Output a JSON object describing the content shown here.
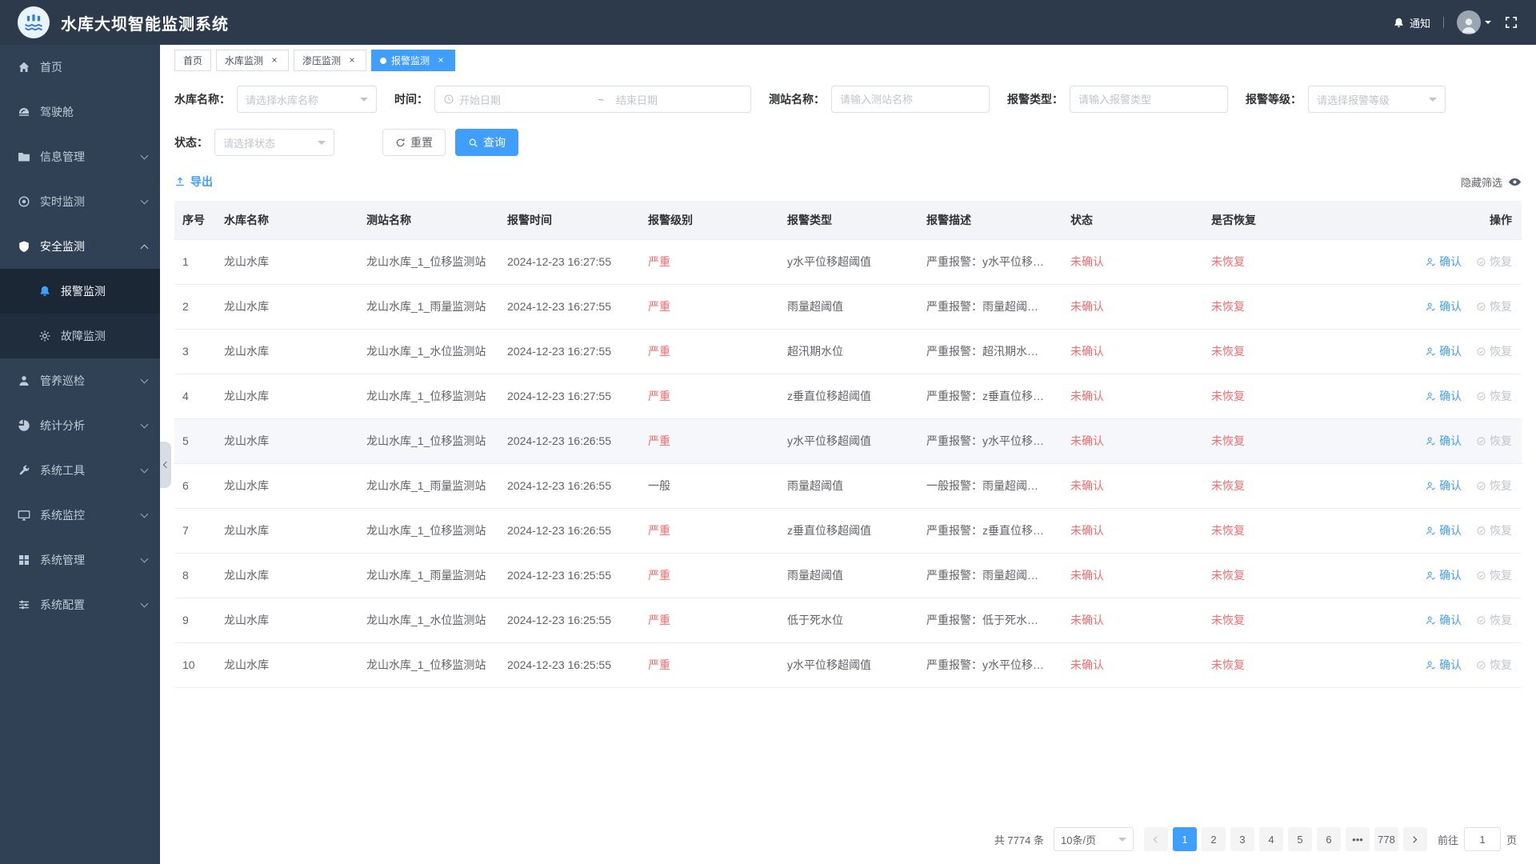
{
  "colors": {
    "primary": "#409eff",
    "danger": "#f56c6c",
    "header_bg": "#2d3a4b",
    "sidebar_bg": "#304156",
    "submenu_bg": "#1f2d3d"
  },
  "icons": {
    "app_logo": "dam-waves",
    "notification": "bell",
    "avatar": "user-photo",
    "fullscreen": "expand-corners",
    "export": "upload-arrow",
    "hide_filter": "eye",
    "query": "magnifier",
    "reset": "refresh-arrow",
    "date": "clock",
    "confirm_op": "user-check",
    "recover_op": "circle-check"
  },
  "header": {
    "title": "水库大坝智能监测系统",
    "notification_label": "通知"
  },
  "sidebar": {
    "items": [
      {
        "label": "首页"
      },
      {
        "label": "驾驶舱"
      },
      {
        "label": "信息管理"
      },
      {
        "label": "实时监测"
      },
      {
        "label": "安全监测",
        "children": [
          {
            "label": "报警监测"
          },
          {
            "label": "故障监测"
          }
        ]
      },
      {
        "label": "管养巡检"
      },
      {
        "label": "统计分析"
      },
      {
        "label": "系统工具"
      },
      {
        "label": "系统监控"
      },
      {
        "label": "系统管理"
      },
      {
        "label": "系统配置"
      }
    ]
  },
  "tabs": [
    {
      "label": "首页"
    },
    {
      "label": "水库监测"
    },
    {
      "label": "渗压监测"
    },
    {
      "label": "报警监测"
    }
  ],
  "filters": {
    "reservoir_label": "水库名称：",
    "reservoir_placeholder": "请选择水库名称",
    "time_label": "时间：",
    "start_placeholder": "开始日期",
    "separator": "~",
    "end_placeholder": "结束日期",
    "station_label": "测站名称：",
    "station_placeholder": "请输入测站名称",
    "type_label": "报警类型：",
    "type_placeholder": "请输入报警类型",
    "level_label": "报警等级：",
    "level_placeholder": "请选择报警等级",
    "status_label": "状态：",
    "status_placeholder": "请选择状态",
    "reset_label": "重置",
    "query_label": "查询"
  },
  "toolbar": {
    "export_label": "导出",
    "hide_filter_label": "隐藏筛选"
  },
  "table": {
    "columns": [
      "序号",
      "水库名称",
      "测站名称",
      "报警时间",
      "报警级别",
      "报警类型",
      "报警描述",
      "状态",
      "是否恢复",
      "操作"
    ],
    "confirm_label": "确认",
    "recover_label": "恢复",
    "rows": [
      {
        "no": "1",
        "reservoir": "龙山水库",
        "station": "龙山水库_1_位移监测站",
        "time": "2024-12-23 16:27:55",
        "level": "严重",
        "level_class": "red",
        "type": "y水平位移超阈值",
        "desc": "严重报警：y水平位移…",
        "status": "未确认",
        "recovered": "未恢复",
        "row_class": ""
      },
      {
        "no": "2",
        "reservoir": "龙山水库",
        "station": "龙山水库_1_雨量监测站",
        "time": "2024-12-23 16:27:55",
        "level": "严重",
        "level_class": "red",
        "type": "雨量超阈值",
        "desc": "严重报警：雨量超阈…",
        "status": "未确认",
        "recovered": "未恢复",
        "row_class": ""
      },
      {
        "no": "3",
        "reservoir": "龙山水库",
        "station": "龙山水库_1_水位监测站",
        "time": "2024-12-23 16:27:55",
        "level": "严重",
        "level_class": "red",
        "type": "超汛期水位",
        "desc": "严重报警：超汛期水…",
        "status": "未确认",
        "recovered": "未恢复",
        "row_class": ""
      },
      {
        "no": "4",
        "reservoir": "龙山水库",
        "station": "龙山水库_1_位移监测站",
        "time": "2024-12-23 16:27:55",
        "level": "严重",
        "level_class": "red",
        "type": "z垂直位移超阈值",
        "desc": "严重报警：z垂直位移…",
        "status": "未确认",
        "recovered": "未恢复",
        "row_class": ""
      },
      {
        "no": "5",
        "reservoir": "龙山水库",
        "station": "龙山水库_1_位移监测站",
        "time": "2024-12-23 16:26:55",
        "level": "严重",
        "level_class": "red",
        "type": "y水平位移超阈值",
        "desc": "严重报警：y水平位移…",
        "status": "未确认",
        "recovered": "未恢复",
        "row_class": "hl"
      },
      {
        "no": "6",
        "reservoir": "龙山水库",
        "station": "龙山水库_1_雨量监测站",
        "time": "2024-12-23 16:26:55",
        "level": "一般",
        "level_class": "plain",
        "type": "雨量超阈值",
        "desc": "一般报警：雨量超阈…",
        "status": "未确认",
        "recovered": "未恢复",
        "row_class": ""
      },
      {
        "no": "7",
        "reservoir": "龙山水库",
        "station": "龙山水库_1_位移监测站",
        "time": "2024-12-23 16:26:55",
        "level": "严重",
        "level_class": "red",
        "type": "z垂直位移超阈值",
        "desc": "严重报警：z垂直位移…",
        "status": "未确认",
        "recovered": "未恢复",
        "row_class": ""
      },
      {
        "no": "8",
        "reservoir": "龙山水库",
        "station": "龙山水库_1_雨量监测站",
        "time": "2024-12-23 16:25:55",
        "level": "严重",
        "level_class": "red",
        "type": "雨量超阈值",
        "desc": "严重报警：雨量超阈…",
        "status": "未确认",
        "recovered": "未恢复",
        "row_class": ""
      },
      {
        "no": "9",
        "reservoir": "龙山水库",
        "station": "龙山水库_1_水位监测站",
        "time": "2024-12-23 16:25:55",
        "level": "严重",
        "level_class": "red",
        "type": "低于死水位",
        "desc": "严重报警：低于死水…",
        "status": "未确认",
        "recovered": "未恢复",
        "row_class": ""
      },
      {
        "no": "10",
        "reservoir": "龙山水库",
        "station": "龙山水库_1_位移监测站",
        "time": "2024-12-23 16:25:55",
        "level": "严重",
        "level_class": "red",
        "type": "y水平位移超阈值",
        "desc": "严重报警：y水平位移…",
        "status": "未确认",
        "recovered": "未恢复",
        "row_class": ""
      }
    ]
  },
  "pagination": {
    "total": "共 7774 条",
    "page_size": "10条/页",
    "pages": [
      {
        "label": "1",
        "cls": "active"
      },
      {
        "label": "2",
        "cls": ""
      },
      {
        "label": "3",
        "cls": ""
      },
      {
        "label": "4",
        "cls": ""
      },
      {
        "label": "5",
        "cls": ""
      },
      {
        "label": "6",
        "cls": ""
      }
    ],
    "ellipsis": "•••",
    "last_page": "778",
    "goto_label": "前往",
    "goto_value": "1",
    "page_suffix": "页"
  }
}
